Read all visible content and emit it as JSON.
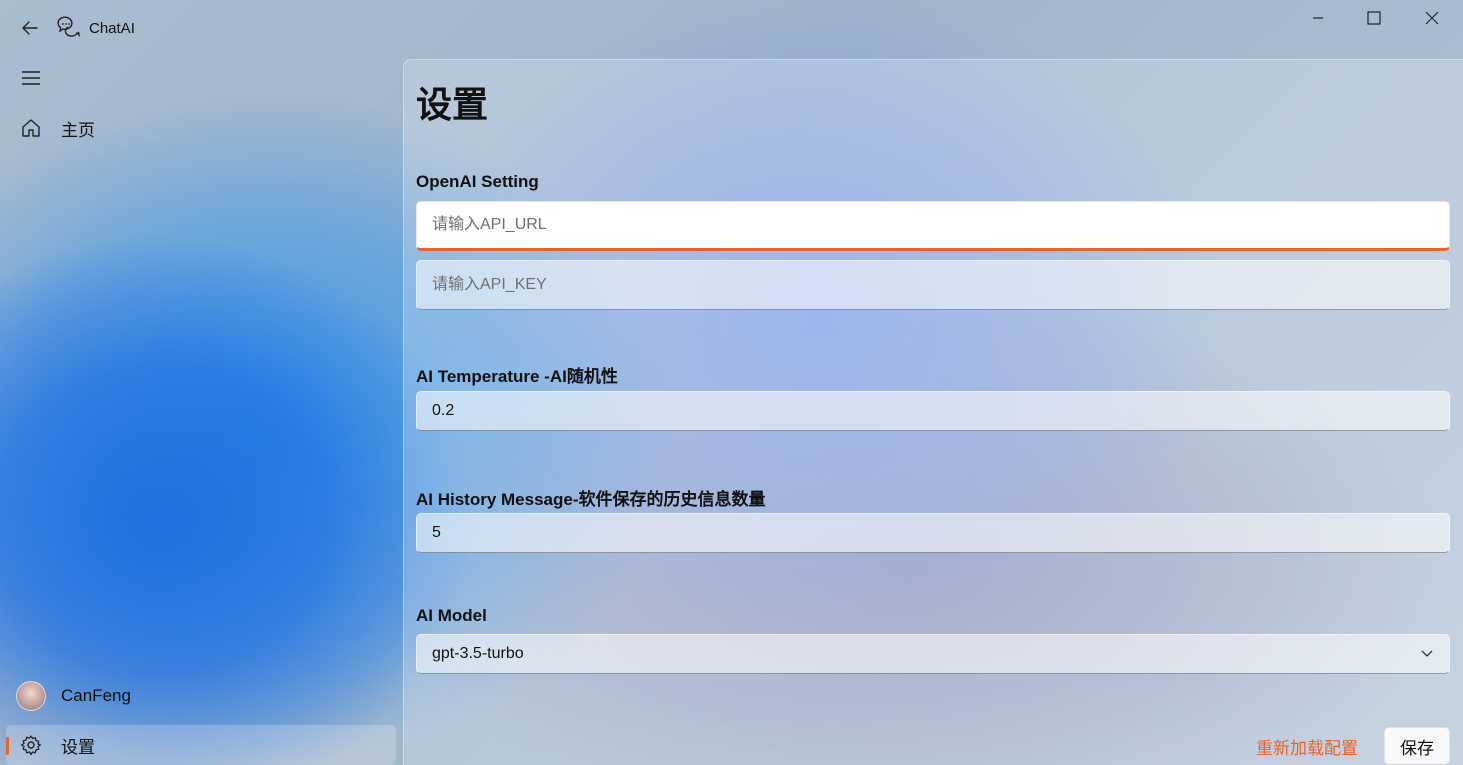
{
  "app": {
    "title": "ChatAI"
  },
  "nav": {
    "home_label": "主页",
    "user_name": "CanFeng",
    "settings_label": "设置"
  },
  "page": {
    "title": "设置"
  },
  "openai": {
    "label": "OpenAI Setting",
    "api_url_placeholder": "请输入API_URL",
    "api_url_value": "",
    "api_key_placeholder": "请输入API_KEY",
    "api_key_value": ""
  },
  "temperature": {
    "label": "AI Temperature -AI随机性",
    "value": "0.2"
  },
  "history": {
    "label": "AI History Message-软件保存的历史信息数量",
    "value": "5"
  },
  "model": {
    "label": "AI Model",
    "selected": "gpt-3.5-turbo"
  },
  "actions": {
    "reload_label": "重新加载配置",
    "save_label": "保存"
  },
  "colors": {
    "accent": "#e8632a"
  }
}
